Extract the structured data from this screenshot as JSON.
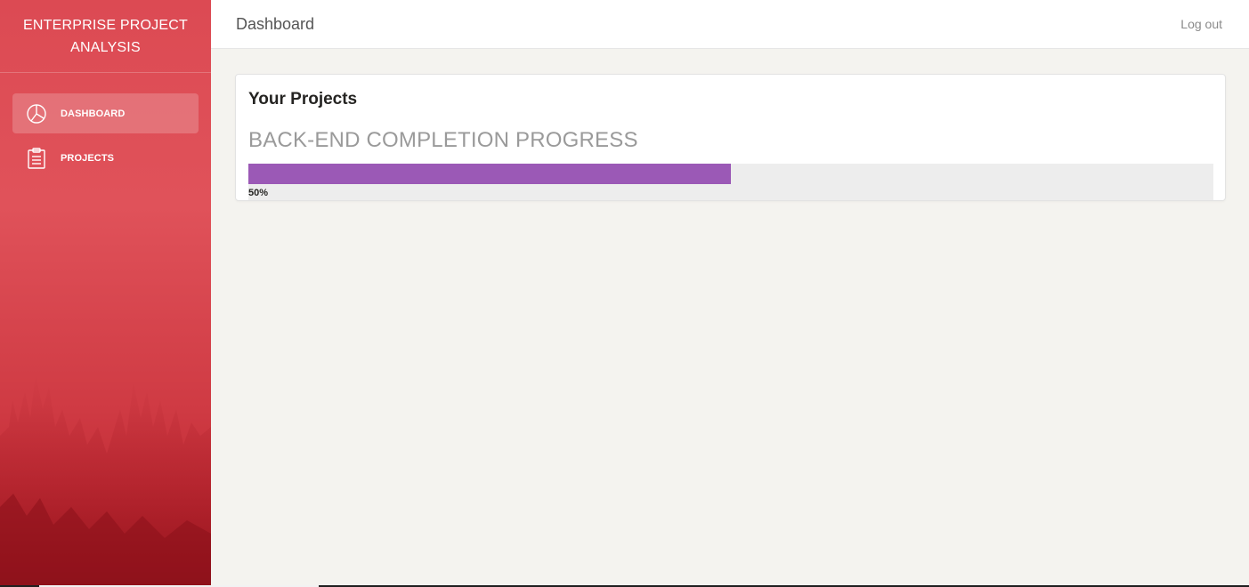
{
  "sidebar": {
    "brand": "ENTERPRISE PROJECT ANALYSIS",
    "items": [
      {
        "label": "DASHBOARD",
        "icon": "pie-chart-icon",
        "active": true
      },
      {
        "label": "PROJECTS",
        "icon": "clipboard-icon",
        "active": false
      }
    ]
  },
  "topbar": {
    "title": "Dashboard",
    "logout_label": "Log out"
  },
  "card": {
    "title": "Your Projects",
    "subtitle": "BACK-END COMPLETION PROGRESS",
    "progress": {
      "value": 50,
      "label": "50%",
      "color": "#9b59b6"
    }
  },
  "colors": {
    "sidebar_accent": "#dc4a53",
    "progress_track": "#ededed"
  }
}
